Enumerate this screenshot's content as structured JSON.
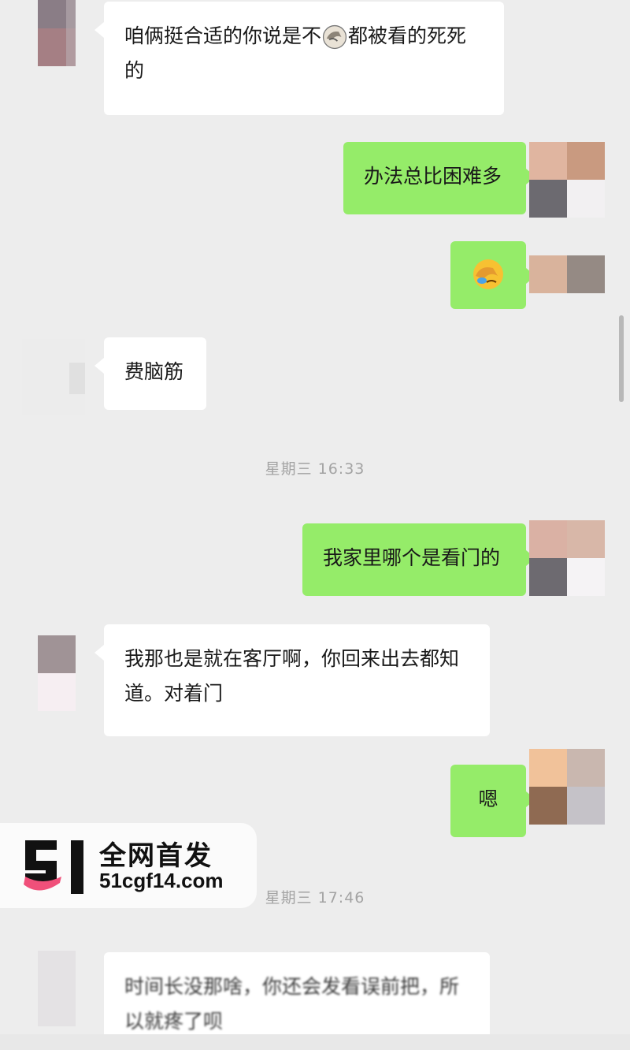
{
  "messages": [
    {
      "side": "in",
      "text_before": "咱俩挺合适的你说是不",
      "emoji": "facepalm-emoji",
      "text_after": "都被看的死死的"
    },
    {
      "side": "out",
      "text": "办法总比困难多"
    },
    {
      "side": "out",
      "emoji": "facepalm-emoji"
    },
    {
      "side": "in",
      "text": "费脑筋"
    },
    {
      "side": "out",
      "text": "我家里哪个是看门的"
    },
    {
      "side": "in",
      "text": "我那也是就在客厅啊，你回来出去都知道。对着门"
    },
    {
      "side": "out",
      "text": "嗯"
    },
    {
      "side": "in",
      "text": "时间长没那啥，你还会发看误前把，所以就疼了呗"
    }
  ],
  "timestamps": [
    "星期三 16:33",
    "星期三 17:46"
  ],
  "watermark": {
    "title": "全网首发",
    "url": "51cgf14.com",
    "logo_text": "51"
  },
  "colors": {
    "background": "#ededed",
    "bubble_in": "#ffffff",
    "bubble_out": "#95ec69",
    "logo_pink": "#f0507a",
    "text": "#191919",
    "timestamp": "#a3a3a3"
  }
}
